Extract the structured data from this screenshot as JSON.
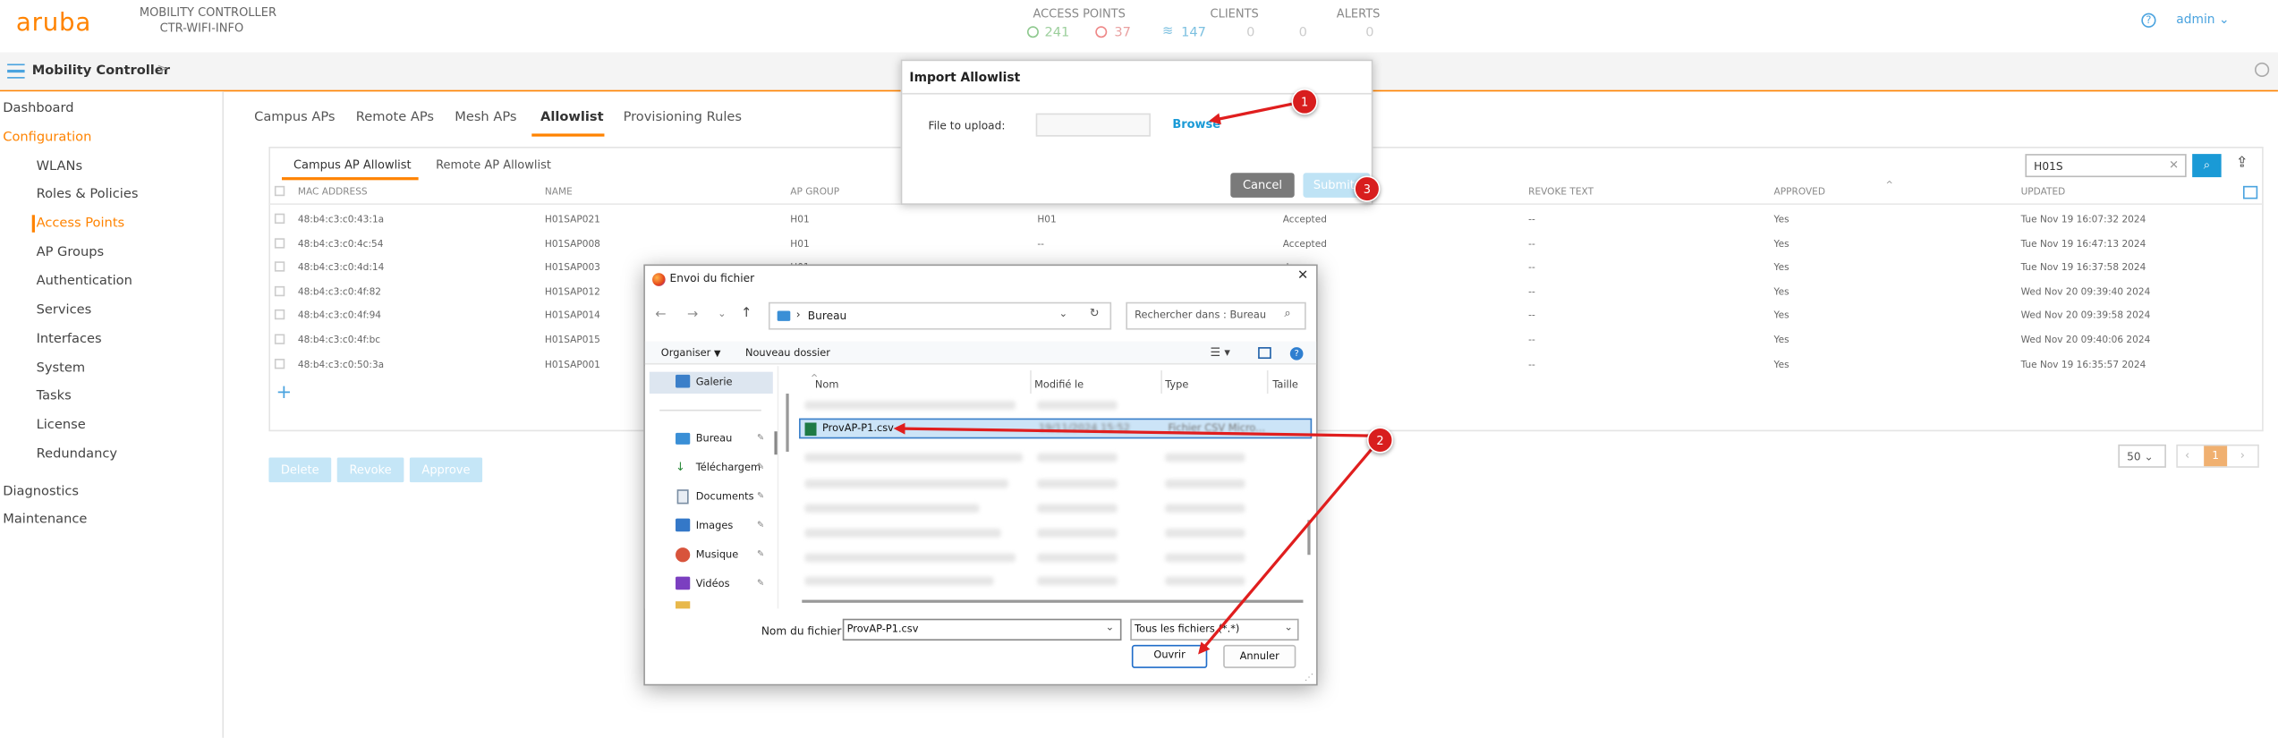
{
  "header": {
    "logo": "aruba",
    "product_line1": "MOBILITY CONTROLLER",
    "product_line2": "CTR-WIFI-INFO",
    "access_points_title": "ACCESS POINTS",
    "ap_up": "241",
    "ap_down": "37",
    "clients_title": "CLIENTS",
    "clients_wifi": "147",
    "clients_2": "0",
    "clients_3": "0",
    "alerts_title": "ALERTS",
    "alerts_count": "0",
    "user": "admin",
    "accent_color": "#ff8300"
  },
  "subbar": {
    "title": "Mobility Controller",
    "chevron": ">"
  },
  "sidebar": {
    "items": [
      {
        "label": "Dashboard"
      },
      {
        "label": "Configuration"
      },
      {
        "label": "WLANs"
      },
      {
        "label": "Roles & Policies"
      },
      {
        "label": "Access Points"
      },
      {
        "label": "AP Groups"
      },
      {
        "label": "Authentication"
      },
      {
        "label": "Services"
      },
      {
        "label": "Interfaces"
      },
      {
        "label": "System"
      },
      {
        "label": "Tasks"
      },
      {
        "label": "License"
      },
      {
        "label": "Redundancy"
      },
      {
        "label": "Diagnostics"
      },
      {
        "label": "Maintenance"
      }
    ]
  },
  "tabs": [
    "Campus APs",
    "Remote APs",
    "Mesh APs",
    "Allowlist",
    "Provisioning Rules"
  ],
  "subtabs": [
    "Campus AP Allowlist",
    "Remote AP Allowlist"
  ],
  "search": {
    "value": "H01S"
  },
  "table": {
    "headers": [
      "MAC ADDRESS",
      "NAME",
      "AP GROUP",
      "REVOKE TEXT",
      "APPROVED",
      "UPDATED"
    ],
    "rows": [
      {
        "mac": "48:b4:c3:c0:43:1a",
        "name": "H01SAP021",
        "group": "H01",
        "c4": "H01",
        "state": "Accepted",
        "revoke": "--",
        "approved": "Yes",
        "updated": "Tue Nov 19 16:07:32 2024"
      },
      {
        "mac": "48:b4:c3:c0:4c:54",
        "name": "H01SAP008",
        "group": "H01",
        "c4": "--",
        "state": "Accepted",
        "revoke": "--",
        "approved": "Yes",
        "updated": "Tue Nov 19 16:47:13 2024"
      },
      {
        "mac": "48:b4:c3:c0:4d:14",
        "name": "H01SAP003",
        "group": "H01",
        "c4": "",
        "state": "d",
        "revoke": "--",
        "approved": "Yes",
        "updated": "Tue Nov 19 16:37:58 2024"
      },
      {
        "mac": "48:b4:c3:c0:4f:82",
        "name": "H01SAP012",
        "group": "H01",
        "c4": "",
        "state": "d",
        "revoke": "--",
        "approved": "Yes",
        "updated": "Wed Nov 20 09:39:40 2024"
      },
      {
        "mac": "48:b4:c3:c0:4f:94",
        "name": "H01SAP014",
        "group": "H01",
        "c4": "",
        "state": "d",
        "revoke": "--",
        "approved": "Yes",
        "updated": "Wed Nov 20 09:39:58 2024"
      },
      {
        "mac": "48:b4:c3:c0:4f:bc",
        "name": "H01SAP015",
        "group": "H01",
        "c4": "",
        "state": "d",
        "revoke": "--",
        "approved": "Yes",
        "updated": "Wed Nov 20 09:40:06 2024"
      },
      {
        "mac": "48:b4:c3:c0:50:3a",
        "name": "H01SAP001",
        "group": "H01",
        "c4": "",
        "state": "d",
        "revoke": "--",
        "approved": "Yes",
        "updated": "Tue Nov 19 16:35:57 2024"
      }
    ],
    "add_symbol": "+"
  },
  "actions": {
    "delete": "Delete",
    "revoke": "Revoke",
    "approve": "Approve"
  },
  "pagination": {
    "per_page": "50",
    "page": "1"
  },
  "import_modal": {
    "title": "Import Allowlist",
    "file_label": "File to upload:",
    "browse": "Browse",
    "cancel": "Cancel",
    "submit": "Submit"
  },
  "file_dialog": {
    "title": "Envoi du fichier",
    "path": "Bureau",
    "search_placeholder": "Rechercher dans : Bureau",
    "organize": "Organiser",
    "new_folder": "Nouveau dossier",
    "nav_items": [
      "Galerie",
      "Bureau",
      "Téléchargem",
      "Documents",
      "Images",
      "Musique",
      "Vidéos"
    ],
    "columns": [
      "Nom",
      "Modifié le",
      "Type",
      "Taille"
    ],
    "selected_file": {
      "name": "ProvAP-P1.csv",
      "modified": "19/11/2024 15:52",
      "type": "Fichier CSV Micro..."
    },
    "filename_label": "Nom du fichier :",
    "filename_value": "ProvAP-P1.csv",
    "filter": "Tous les fichiers (*.*)",
    "open": "Ouvrir",
    "cancel": "Annuler"
  },
  "annotations": [
    "1",
    "2",
    "3"
  ]
}
